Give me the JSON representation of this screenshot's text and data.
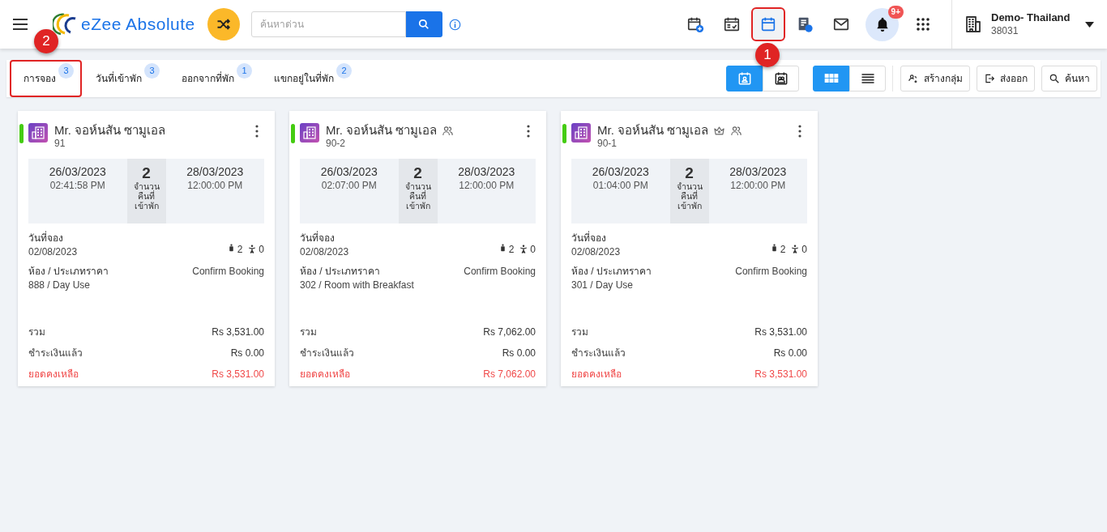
{
  "header": {
    "brand": "eZee Absolute",
    "search": {
      "placeholder": "ค้นหาด่วน"
    },
    "icons": [
      {
        "kind": "calendar-add",
        "selected": false,
        "highlighted": false
      },
      {
        "kind": "calendar-check",
        "selected": false,
        "highlighted": false
      },
      {
        "kind": "calendar",
        "selected": true,
        "highlighted": true,
        "callout": "1"
      },
      {
        "kind": "invoice",
        "selected": false,
        "highlighted": false
      },
      {
        "kind": "mail",
        "selected": false,
        "highlighted": false
      }
    ],
    "notifications": {
      "badge": "9+"
    },
    "property": {
      "name": "Demo- Thailand",
      "code": "38031"
    }
  },
  "tabs": [
    {
      "label": "การจอง",
      "count": "3",
      "highlighted": true,
      "callout": "2"
    },
    {
      "label": "วันที่เข้าพัก",
      "count": "3",
      "highlighted": false
    },
    {
      "label": "ออกจากที่พัก",
      "count": "1",
      "highlighted": false
    },
    {
      "label": "แขกอยู่ในที่พัก",
      "count": "2",
      "highlighted": false
    }
  ],
  "view_toggles": [
    [
      {
        "kind": "guest-calendar",
        "selected": true
      },
      {
        "kind": "group-calendar",
        "selected": false
      }
    ],
    [
      {
        "kind": "grid",
        "selected": true
      },
      {
        "kind": "list",
        "selected": false
      }
    ]
  ],
  "actions": [
    {
      "kind": "group",
      "label": "สร้างกลุ่ม"
    },
    {
      "kind": "export",
      "label": "ส่งออก"
    },
    {
      "kind": "search",
      "label": "ค้นหา"
    }
  ],
  "cards": [
    {
      "color": "#44cc11",
      "name": "Mr. จอห์นสัน ซามูเอล",
      "room_no": "91",
      "arrival_date": "26/03/2023",
      "arrival_time": "02:41:58 PM",
      "nights": "2",
      "nights_label": "จำนวนคืนที่เข้าพัก",
      "departure_date": "28/03/2023",
      "departure_time": "12:00:00 PM",
      "booking_label": "วันที่จอง",
      "booking_date": "02/08/2023",
      "adults": "2",
      "children": "0",
      "room_label": "ห้อง / ประเภทราคา",
      "room": "888 / Day Use",
      "status": "Confirm Booking",
      "total_label": "รวม",
      "total": "Rs 3,531.00",
      "paid_label": "ชำระเงินแล้ว",
      "paid": "Rs 0.00",
      "balance_label": "ยอดคงเหลือ",
      "balance": "Rs 3,531.00"
    },
    {
      "color": "#44cc11",
      "name": "Mr. จอห์นสัน ซามูเอล",
      "tags": [
        {
          "kind": "group"
        }
      ],
      "room_no": "90-2",
      "arrival_date": "26/03/2023",
      "arrival_time": "02:07:00 PM",
      "nights": "2",
      "nights_label": "จำนวนคืนที่เข้าพัก",
      "departure_date": "28/03/2023",
      "departure_time": "12:00:00 PM",
      "booking_label": "วันที่จอง",
      "booking_date": "02/08/2023",
      "adults": "2",
      "children": "0",
      "room_label": "ห้อง / ประเภทราคา",
      "room": "302 / Room with Breakfast",
      "status": "Confirm Booking",
      "total_label": "รวม",
      "total": "Rs 7,062.00",
      "paid_label": "ชำระเงินแล้ว",
      "paid": "Rs 0.00",
      "balance_label": "ยอดคงเหลือ",
      "balance": "Rs 7,062.00"
    },
    {
      "color": "#44cc11",
      "name": "Mr. จอห์นสัน ซามูเอล",
      "tags": [
        {
          "kind": "vip"
        },
        {
          "kind": "group"
        }
      ],
      "room_no": "90-1",
      "arrival_date": "26/03/2023",
      "arrival_time": "01:04:00 PM",
      "nights": "2",
      "nights_label": "จำนวนคืนที่เข้าพัก",
      "departure_date": "28/03/2023",
      "departure_time": "12:00:00 PM",
      "booking_label": "วันที่จอง",
      "booking_date": "02/08/2023",
      "adults": "2",
      "children": "0",
      "room_label": "ห้อง / ประเภทราคา",
      "room": "301 / Day Use",
      "status": "Confirm Booking",
      "total_label": "รวม",
      "total": "Rs 3,531.00",
      "paid_label": "ชำระเงินแล้ว",
      "paid": "Rs 0.00",
      "balance_label": "ยอดคงเหลือ",
      "balance": "Rs 3,531.00"
    }
  ]
}
